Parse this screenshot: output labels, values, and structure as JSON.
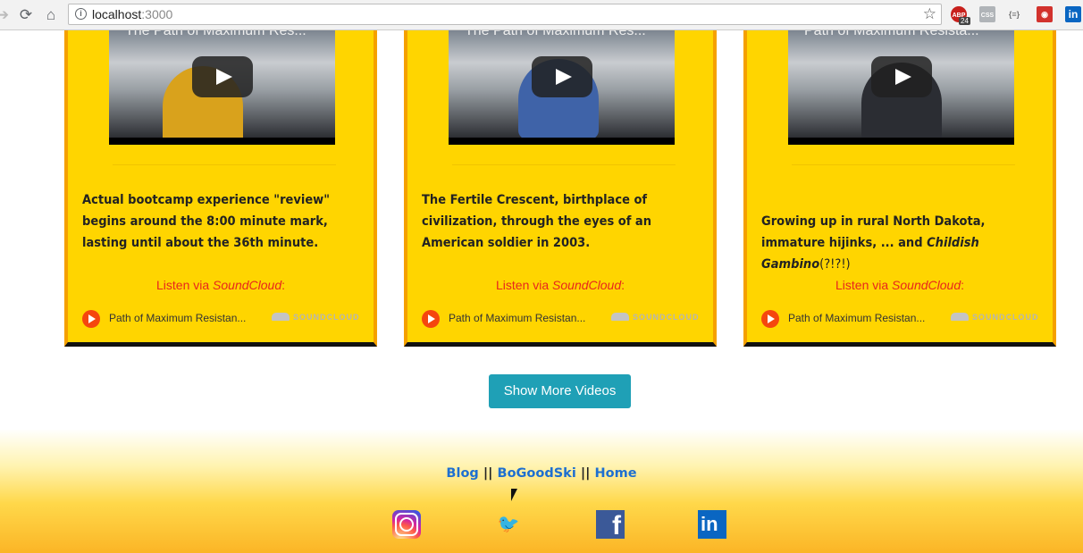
{
  "browser": {
    "url_host": "localhost",
    "url_port": ":3000",
    "extensions": [
      {
        "name": "adblock-extension",
        "label": "ABP",
        "badge": "24",
        "color": "#c8201c"
      },
      {
        "name": "extension-2",
        "label": "CSS",
        "color": "#9aa0a6"
      },
      {
        "name": "json-extension",
        "label": "{≡}",
        "color": "#9aa0a6"
      },
      {
        "name": "extension-4",
        "label": "◉",
        "color": "#d2322d"
      },
      {
        "name": "linkedin-extension",
        "label": "in",
        "color": "#0a66c2"
      }
    ]
  },
  "cards": [
    {
      "video_title": "The Path of Maximum Res...",
      "description_parts": [
        "Actual bootcamp experience \"review\" begins around the 8:00 minute mark, lasting until about the 36th minute."
      ],
      "listen_prefix": "Listen via ",
      "listen_link": "SoundCloud",
      "listen_suffix": ":",
      "track": "Path of Maximum Resistan...",
      "sc_brand": "SOUNDCLOUD"
    },
    {
      "video_title": "The Path of Maximum Res...",
      "description_parts": [
        "The Fertile Crescent, birthplace of civilization, through the eyes of an American soldier in 2003."
      ],
      "listen_prefix": "Listen via ",
      "listen_link": "SoundCloud",
      "listen_suffix": ":",
      "track": "Path of Maximum Resistan...",
      "sc_brand": "SOUNDCLOUD"
    },
    {
      "video_title": "Path of Maximum Resista...",
      "description_parts": [
        "Growing up in rural North Dakota, immature hijinks, ... and ",
        "Childish Gambino",
        "(?!?!)"
      ],
      "listen_prefix": "Listen via ",
      "listen_link": "SoundCloud",
      "listen_suffix": ":",
      "track": "Path of Maximum Resistan...",
      "sc_brand": "SOUNDCLOUD"
    }
  ],
  "show_more_label": "Show More Videos",
  "footer": {
    "links": [
      "Blog",
      "BoGoodSki",
      "Home"
    ],
    "separator": "||",
    "social": [
      "instagram",
      "twitter",
      "facebook",
      "linkedin"
    ],
    "facebook_glyph": "f",
    "linkedin_glyph": "in",
    "twitter_glyph": "🐦"
  },
  "colors": {
    "card_bg": "#ffd500",
    "card_border": "#f5a000",
    "accent_red": "#e8261c",
    "button": "#1fa0b6",
    "link_blue": "#1e6fd0"
  }
}
